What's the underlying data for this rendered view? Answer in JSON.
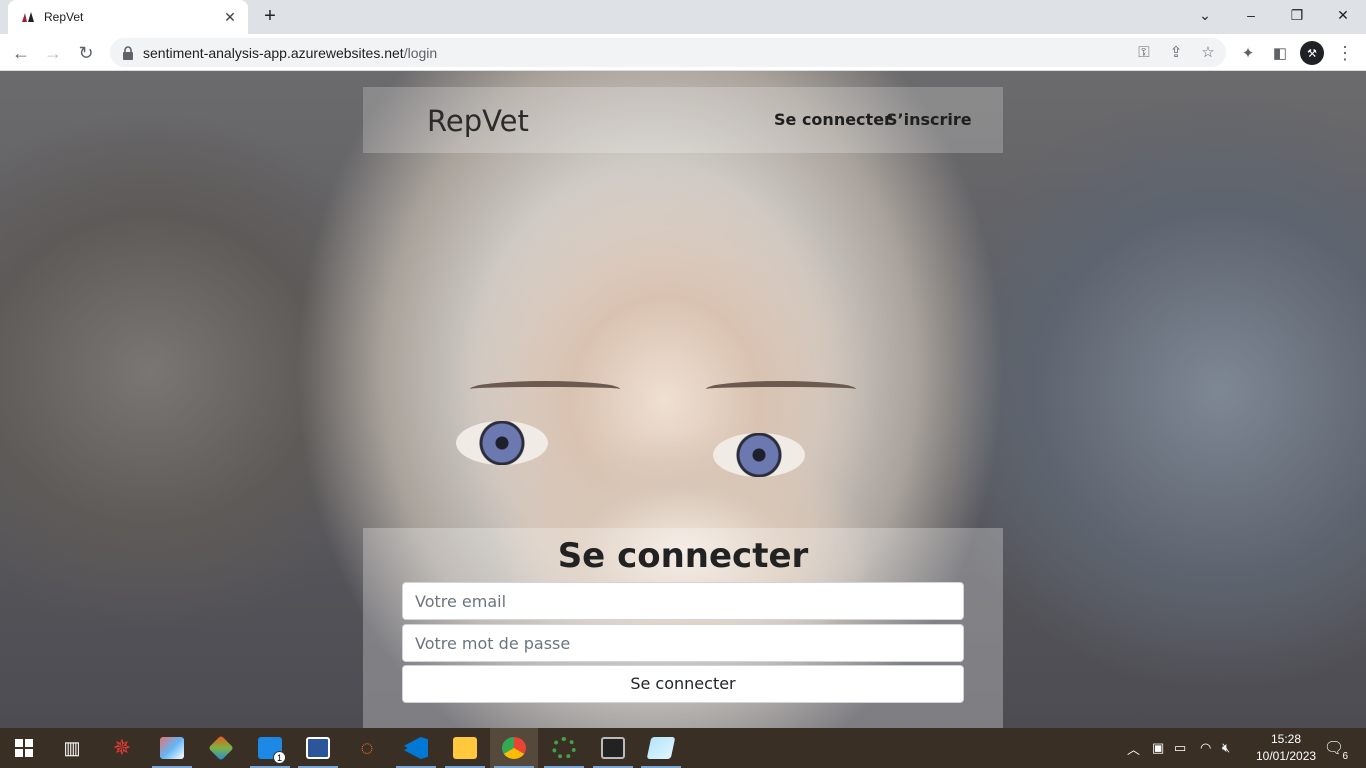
{
  "browser": {
    "tab_title": "RepVet",
    "new_tab_symbol": "+",
    "url_host": "sentiment-analysis-app.azurewebsites.net",
    "url_path": "/login"
  },
  "page": {
    "logo": "RepVet",
    "nav": {
      "login": "Se connecter",
      "register": "S’inscrire"
    },
    "login_form": {
      "title": "Se connecter",
      "email_placeholder": "Votre email",
      "password_placeholder": "Votre mot de passe",
      "submit_label": "Se connecter"
    }
  },
  "taskbar": {
    "apps": [
      {
        "name": "start",
        "icon": "windows-logo-icon"
      },
      {
        "name": "task-view",
        "icon": "task-view-icon"
      },
      {
        "name": "app-1",
        "icon": "spider-icon"
      },
      {
        "name": "app-2",
        "icon": "paint-icon"
      },
      {
        "name": "app-3",
        "icon": "git-icon"
      },
      {
        "name": "mail",
        "icon": "mail-icon",
        "badge": "1"
      },
      {
        "name": "word",
        "icon": "word-icon"
      },
      {
        "name": "jupyter",
        "icon": "jupyter-icon"
      },
      {
        "name": "vscode",
        "icon": "vscode-icon"
      },
      {
        "name": "explorer",
        "icon": "folder-icon"
      },
      {
        "name": "chrome",
        "icon": "chrome-icon"
      },
      {
        "name": "app-4",
        "icon": "ring-icon"
      },
      {
        "name": "terminal",
        "icon": "terminal-icon"
      },
      {
        "name": "app-5",
        "icon": "notes-icon"
      }
    ],
    "time": "15:28",
    "date": "10/01/2023",
    "notification_count": "6"
  },
  "colors": {
    "tabstrip": "#dee1e6",
    "taskbar": "#3a2f25",
    "accent": "#7aa6d8"
  }
}
